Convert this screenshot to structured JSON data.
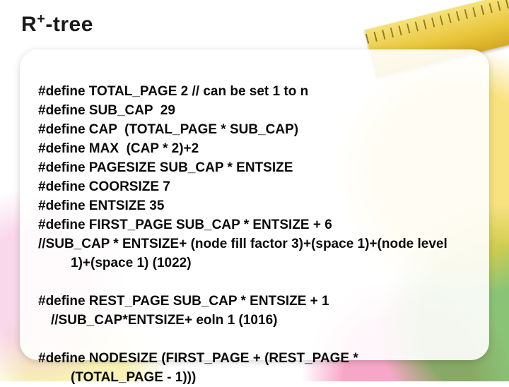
{
  "title_prefix": "R",
  "title_sup": "+",
  "title_suffix": "-tree",
  "code": {
    "l1": "#define TOTAL_PAGE 2 // can be set 1 to n",
    "l2": "#define SUB_CAP  29",
    "l3": "#define CAP  (TOTAL_PAGE * SUB_CAP)",
    "l4": "#define MAX  (CAP * 2)+2",
    "l5": "#define PAGESIZE SUB_CAP * ENTSIZE",
    "l6": "#define COORSIZE 7",
    "l7": "#define ENTSIZE 35",
    "l8": "#define FIRST_PAGE SUB_CAP * ENTSIZE + 6",
    "l9": "//SUB_CAP * ENTSIZE+ (node fill factor 3)+(space 1)+(node level",
    "l9b": "1)+(space 1) (1022)",
    "l10": "#define REST_PAGE SUB_CAP * ENTSIZE + 1",
    "l11": "//SUB_CAP*ENTSIZE+ eoln 1 (1016)",
    "l12": "#define NODESIZE (FIRST_PAGE + (REST_PAGE *",
    "l12b": "(TOTAL_PAGE - 1)))"
  }
}
